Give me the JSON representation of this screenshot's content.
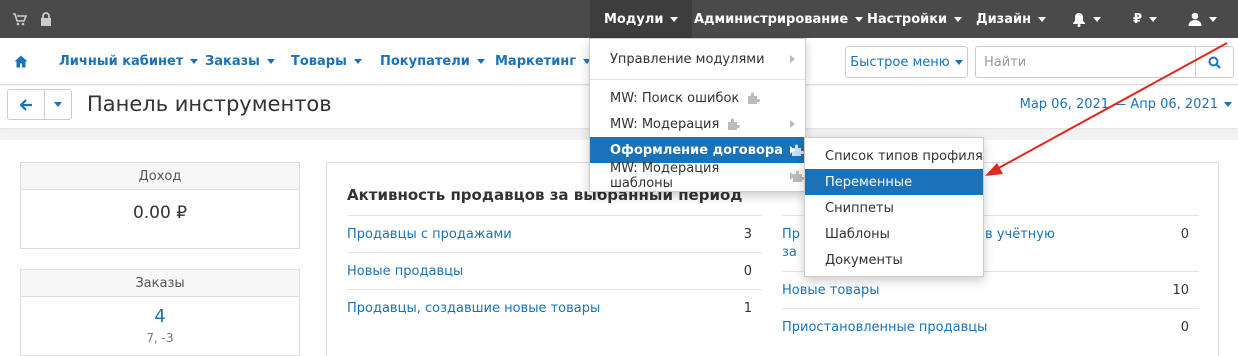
{
  "topbar": {
    "menus": [
      {
        "label": "Модули"
      },
      {
        "label": "Администрирование"
      },
      {
        "label": "Настройки"
      },
      {
        "label": "Дизайн"
      }
    ],
    "currency": "₽"
  },
  "nav": {
    "items": [
      {
        "label": "Личный кабинет"
      },
      {
        "label": "Заказы"
      },
      {
        "label": "Товары"
      },
      {
        "label": "Покупатели"
      },
      {
        "label": "Маркетинг"
      }
    ],
    "quick_menu": "Быстрое меню",
    "search_placeholder": "Найти"
  },
  "titlebar": {
    "title": "Панель инструментов",
    "date_range": "Мар 06, 2021 — Апр 06, 2021"
  },
  "stats": {
    "income": {
      "label": "Доход",
      "value": "0.00 ₽"
    },
    "orders": {
      "label": "Заказы",
      "value": "4",
      "sub": "7, -3"
    }
  },
  "activity": {
    "title": "Активность продавцов за выбранный период",
    "left_rows": [
      {
        "label": "Продавцы с продажами",
        "value": "3"
      },
      {
        "label": "Новые продавцы",
        "value": "0"
      },
      {
        "label": "Продавцы, создавшие новые товары",
        "value": "1"
      }
    ],
    "right_rows": [
      {
        "label_start": "Пр",
        "label_end": "в учётную",
        "label_line2": "за",
        "value": "0"
      },
      {
        "label": "Новые товары",
        "value": "10"
      },
      {
        "label": "Приостановленные продавцы",
        "value": "0"
      }
    ]
  },
  "modules_menu": {
    "items": [
      {
        "label": "Управление модулями"
      },
      {
        "label": "MW: Поиск ошибок"
      },
      {
        "label": "MW: Модерация"
      },
      {
        "label": "Оформление договора"
      },
      {
        "label": "MW: Модерация шаблоны"
      }
    ]
  },
  "submenu": {
    "items": [
      {
        "label": "Список типов профиля"
      },
      {
        "label": "Переменные"
      },
      {
        "label": "Сниппеты"
      },
      {
        "label": "Шаблоны"
      },
      {
        "label": "Документы"
      }
    ]
  },
  "colors": {
    "accent": "#1a73b8",
    "topbar": "#4a4a4a",
    "annotation_arrow": "#e3261f"
  }
}
